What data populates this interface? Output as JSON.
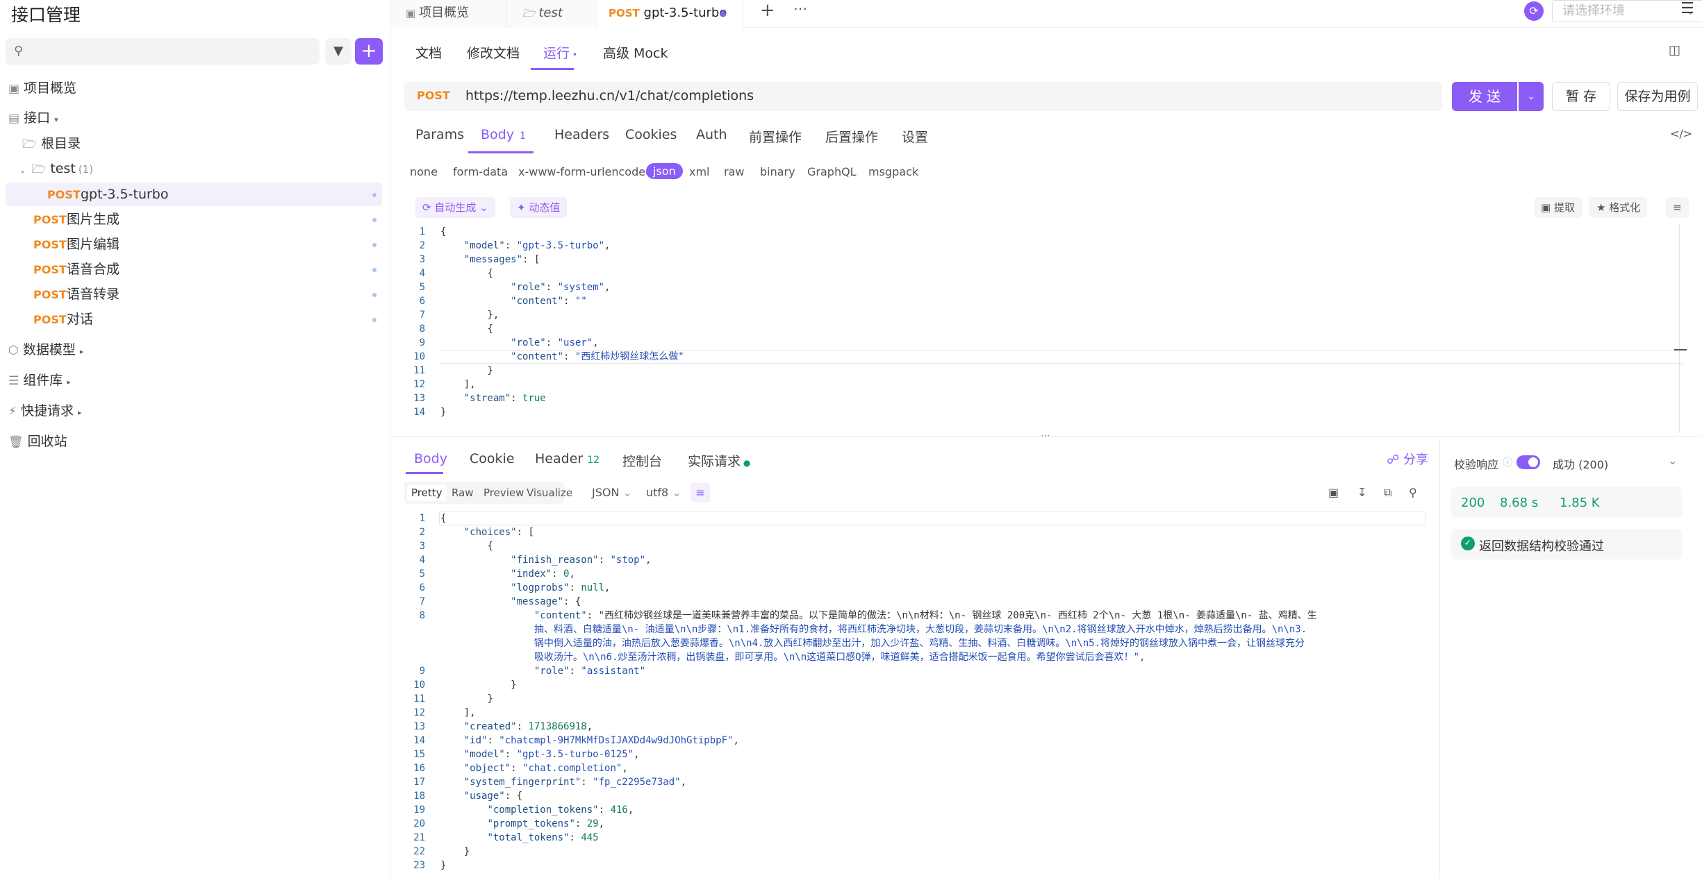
{
  "sidebar": {
    "title": "接口管理",
    "search_placeholder": "",
    "nav": {
      "overview": "项目概览",
      "interfaces": "接口",
      "root": "根目录",
      "folder": "test",
      "folder_count": "(1)",
      "data_models": "数据模型",
      "components": "组件库",
      "quick_requests": "快捷请求",
      "recycle": "回收站"
    },
    "apis": [
      {
        "method": "POST",
        "name": "gpt-3.5-turbo"
      },
      {
        "method": "POST",
        "name": "图片生成"
      },
      {
        "method": "POST",
        "name": "图片编辑"
      },
      {
        "method": "POST",
        "name": "语音合成"
      },
      {
        "method": "POST",
        "name": "语音转录"
      },
      {
        "method": "POST",
        "name": "对话"
      }
    ]
  },
  "top_tabs": [
    {
      "label": "项目概览"
    },
    {
      "label": "test"
    },
    {
      "method": "POST",
      "label": "gpt-3.5-turbo"
    }
  ],
  "env_placeholder": "请选择环境",
  "sub_tabs": [
    "文档",
    "修改文档",
    "运行",
    "高级 Mock"
  ],
  "request": {
    "method": "POST",
    "url": "https://temp.leezhu.cn/v1/chat/completions",
    "send_label": "发 送",
    "save_label": "暂 存",
    "save_case_label": "保存为用例"
  },
  "param_tabs": [
    "Params",
    "Body",
    "Headers",
    "Cookies",
    "Auth",
    "前置操作",
    "后置操作",
    "设置"
  ],
  "body_badge": "1",
  "body_types": [
    "none",
    "form-data",
    "x-www-form-urlencoded",
    "json",
    "xml",
    "raw",
    "binary",
    "GraphQL",
    "msgpack"
  ],
  "editor_tools": {
    "auto_gen": "自动生成",
    "dynamic": "动态值",
    "extract": "提取",
    "format": "格式化"
  },
  "request_body_lines": [
    "{",
    "    \"model\": \"gpt-3.5-turbo\",",
    "    \"messages\": [",
    "        {",
    "            \"role\": \"system\",",
    "            \"content\": \"\"",
    "        },",
    "        {",
    "            \"role\": \"user\",",
    "            \"content\": \"西红柿炒钢丝球怎么做\"",
    "        }",
    "    ],",
    "    \"stream\": true",
    "}"
  ],
  "response_tabs": [
    "Body",
    "Cookie",
    "Header",
    "控制台",
    "实际请求"
  ],
  "header_badge": "12",
  "share_label": "分享",
  "view_modes": [
    "Pretty",
    "Raw",
    "Preview",
    "Visualize"
  ],
  "format_select": "JSON",
  "encoding_select": "utf8",
  "response_lines": [
    "{",
    "    \"choices\": [",
    "        {",
    "            \"finish_reason\": \"stop\",",
    "            \"index\": 0,",
    "            \"logprobs\": null,",
    "            \"message\": {",
    "                \"content\": \"西红柿炒钢丝球是一道美味兼营养丰富的菜品。以下是简单的做法：\\n\\n材料：\\n- 钢丝球 200克\\n- 西红柿 2个\\n- 大葱 1根\\n- 姜蒜适量\\n- 盐、鸡精、生",
    "                抽、料酒、白糖适量\\n- 油适量\\n\\n步骤：\\n1.准备好所有的食材，将西红柿洗净切块，大葱切段，姜蒜切末备用。\\n\\n2.将钢丝球放入开水中焯水，焯熟后捞出备用。\\n\\n3.",
    "                锅中倒入适量的油，油热后放入葱姜蒜爆香。\\n\\n4.放入西红柿翻炒至出汁，加入少许盐、鸡精、生抽、料酒、白糖调味。\\n\\n5.将焯好的钢丝球放入锅中煮一会，让钢丝球充分",
    "                吸收汤汁。\\n\\n6.炒至汤汁浓稠，出锅装盘，即可享用。\\n\\n这道菜口感Q弹，味道鲜美，适合搭配米饭一起食用。希望你尝试后会喜欢！\",",
    "                \"role\": \"assistant\"",
    "            }",
    "        }",
    "    ],",
    "    \"created\": 1713866918,",
    "    \"id\": \"chatcmpl-9H7MkMfDsIJAXDd4w9dJOhGtipbpF\",",
    "    \"model\": \"gpt-3.5-turbo-0125\",",
    "    \"object\": \"chat.completion\",",
    "    \"system_fingerprint\": \"fp_c2295e73ad\",",
    "    \"usage\": {",
    "        \"completion_tokens\": 416,",
    "        \"prompt_tokens\": 29,",
    "        \"total_tokens\": 445",
    "    }",
    "}"
  ],
  "response_line_numbers": [
    "1",
    "2",
    "3",
    "4",
    "5",
    "6",
    "7",
    "8",
    "",
    "",
    "",
    "9",
    "10",
    "11",
    "12",
    "13",
    "14",
    "15",
    "16",
    "17",
    "18",
    "19",
    "20",
    "21",
    "22",
    "23"
  ],
  "validation": {
    "label": "校验响应",
    "status": "成功 (200)",
    "code": "200",
    "time": "8.68 s",
    "size": "1.85 K",
    "result": "返回数据结构校验通过"
  },
  "colors": {
    "accent": "#8b5cf6",
    "method": "#f08a1c",
    "success": "#0e9f6e"
  }
}
